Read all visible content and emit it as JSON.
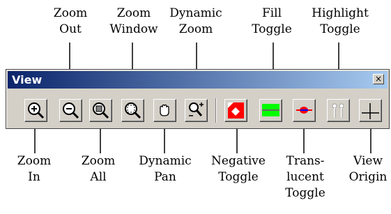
{
  "palette": {
    "title": "View",
    "close_glyph": "×",
    "buttons": [
      {
        "name": "zoom-in",
        "icon": "zoom-in-icon"
      },
      {
        "name": "zoom-out",
        "icon": "zoom-out-icon"
      },
      {
        "name": "zoom-all",
        "icon": "zoom-all-icon"
      },
      {
        "name": "zoom-window",
        "icon": "zoom-window-icon"
      },
      {
        "name": "dynamic-pan",
        "icon": "hand-pan-icon"
      },
      {
        "name": "dynamic-zoom",
        "icon": "dynamic-zoom-icon"
      },
      {
        "name": "negative-toggle",
        "icon": "negative-toggle-icon",
        "color": "#ff0000"
      },
      {
        "name": "fill-toggle",
        "icon": "fill-toggle-icon",
        "color": "#00ff00"
      },
      {
        "name": "translucent-toggle",
        "icon": "translucent-toggle-icon",
        "color": "#ff0000"
      },
      {
        "name": "highlight-toggle",
        "icon": "highlight-toggle-icon",
        "color": "#ffffff"
      },
      {
        "name": "view-origin",
        "icon": "view-origin-icon"
      }
    ]
  },
  "top_labels": {
    "zoom_out": [
      "Zoom",
      "Out"
    ],
    "zoom_window": [
      "Zoom",
      "Window"
    ],
    "dynamic_zoom": [
      "Dynamic",
      "Zoom"
    ],
    "fill_toggle": [
      "Fill",
      "Toggle"
    ],
    "highlight_toggle": [
      "Highlight",
      "Toggle"
    ]
  },
  "bottom_labels": {
    "zoom_in": [
      "Zoom",
      "In"
    ],
    "zoom_all": [
      "Zoom",
      "All"
    ],
    "dynamic_pan": [
      "Dynamic",
      "Pan"
    ],
    "negative_toggle": [
      "Negative",
      "Toggle"
    ],
    "translucent_toggle": [
      "Trans-",
      "lucent",
      "Toggle"
    ],
    "view_origin": [
      "View",
      "Origin"
    ]
  }
}
